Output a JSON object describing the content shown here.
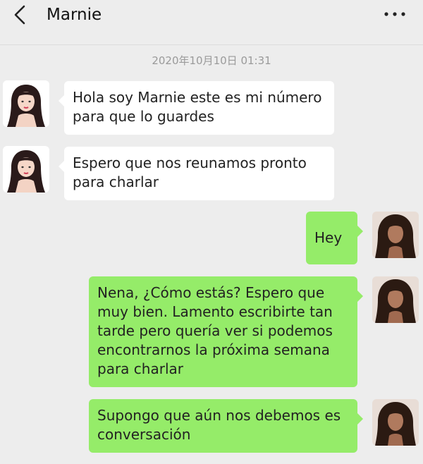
{
  "header": {
    "title": "Marnie",
    "back_icon": "chevron-left-icon",
    "more_icon": "more-dots-icon"
  },
  "chat": {
    "timestamp": "2020年10月10日 01:31",
    "messages": [
      {
        "side": "in",
        "sender": "Marnie",
        "text": "Hola soy Marnie este es mi número para que lo guardes"
      },
      {
        "side": "in",
        "sender": "Marnie",
        "text": "Espero que nos reunamos pronto para charlar"
      },
      {
        "side": "out",
        "sender": "me",
        "text": "Hey"
      },
      {
        "side": "out",
        "sender": "me",
        "text": "Nena, ¿Cómo estás? Espero que muy bien. Lamento escribirte tan tarde pero quería ver si podemos encontrarnos la próxima semana para charlar"
      },
      {
        "side": "out",
        "sender": "me",
        "text": "Supongo que aún nos debemos es conversación"
      }
    ]
  },
  "colors": {
    "background": "#ededed",
    "incoming_bubble": "#ffffff",
    "outgoing_bubble": "#95ec69",
    "timestamp_text": "#9a9a9a"
  }
}
